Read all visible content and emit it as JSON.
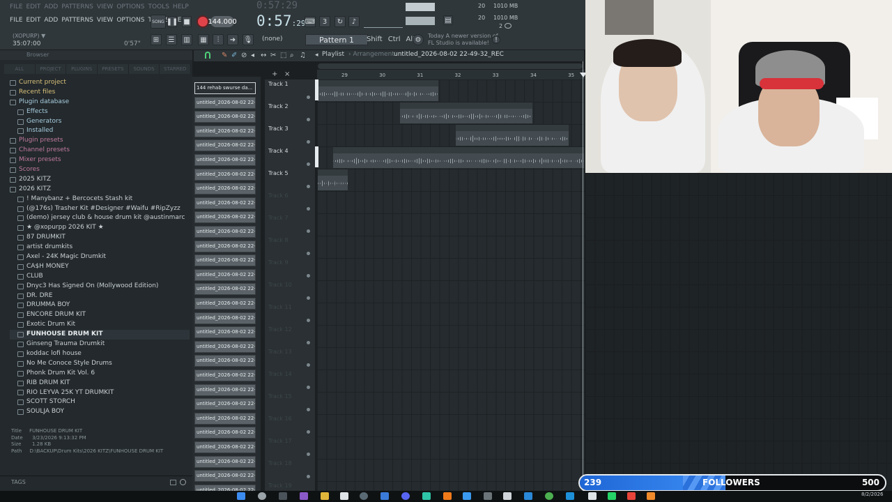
{
  "menu": {
    "items": [
      "FILE",
      "EDIT",
      "ADD",
      "PATTERNS",
      "VIEW",
      "OPTIONS",
      "TOOLS",
      "HELP"
    ]
  },
  "transport": {
    "tempo": "144.000",
    "clock": "0:57",
    "clock_small": ":29",
    "ghost_clock": "0:57:29",
    "song_label": "SONG"
  },
  "project": {
    "label": "(XOPURP) ▼",
    "time": "35:07:00",
    "hint_time": "0'57\""
  },
  "toolbar": {
    "none_label": "(none)",
    "pattern_label": "Pattern 1",
    "keys": [
      "Shift",
      "Ctrl",
      "Alt"
    ],
    "notice_line1": "Today  A newer version of",
    "notice_line2": "FL Studio is available!"
  },
  "status": {
    "cpu1": "20",
    "cpu2": "20",
    "mem1": "1010 MB",
    "mem2": "1010 MB",
    "mem3": "2"
  },
  "browser": {
    "header": "Browser",
    "tabs": [
      "ALL",
      "PROJECT",
      "PLUGINS",
      "PRESETS",
      "SOUNDS",
      "STARRED"
    ],
    "items": [
      {
        "label": "Current project",
        "kind": "cat"
      },
      {
        "label": "Recent files",
        "kind": "cat"
      },
      {
        "label": "Plugin database",
        "kind": "blue"
      },
      {
        "label": "Effects",
        "kind": "blue",
        "indent": 1
      },
      {
        "label": "Generators",
        "kind": "blue",
        "indent": 1
      },
      {
        "label": "Installed",
        "kind": "blue",
        "indent": 1
      },
      {
        "label": "Plugin presets",
        "kind": "cat2"
      },
      {
        "label": "Channel presets",
        "kind": "cat2"
      },
      {
        "label": "Mixer presets",
        "kind": "cat2"
      },
      {
        "label": "Scores",
        "kind": "cat2"
      },
      {
        "label": "2025 KITZ",
        "kind": "folder"
      },
      {
        "label": "2026 KITZ",
        "kind": "folder"
      },
      {
        "label": "! Manybanz + Bercocets Stash kit",
        "kind": "folder",
        "indent": 1
      },
      {
        "label": "(@176s) Trasher Kit #Designer #Waifu #RipZyzz",
        "kind": "folder",
        "indent": 1
      },
      {
        "label": "(demo) jersey club & house drum kit @austinmarc",
        "kind": "folder",
        "indent": 1
      },
      {
        "label": "★ @xopurpp 2026 KIT ★",
        "kind": "folder",
        "indent": 1
      },
      {
        "label": "87 DRUMKIT",
        "kind": "folder",
        "indent": 1
      },
      {
        "label": "artist drumkits",
        "kind": "folder",
        "indent": 1
      },
      {
        "label": "Axel - 24K Magic Drumkit",
        "kind": "folder",
        "indent": 1
      },
      {
        "label": "CA$H MONEY",
        "kind": "folder",
        "indent": 1
      },
      {
        "label": "CLUB",
        "kind": "folder",
        "indent": 1
      },
      {
        "label": "Dnyc3 Has Signed On (Mollywood Edition)",
        "kind": "folder",
        "indent": 1
      },
      {
        "label": "DR. DRE",
        "kind": "folder",
        "indent": 1
      },
      {
        "label": "DRUMMA BOY",
        "kind": "folder",
        "indent": 1
      },
      {
        "label": "ENCORE DRUM KIT",
        "kind": "folder",
        "indent": 1
      },
      {
        "label": "Exotic Drum Kit",
        "kind": "folder",
        "indent": 1
      },
      {
        "label": "FUNHOUSE DRUM KIT",
        "kind": "folder",
        "indent": 1,
        "selected": true
      },
      {
        "label": "Ginseng Trauma Drumkit",
        "kind": "folder",
        "indent": 1
      },
      {
        "label": "koddac lofi house",
        "kind": "folder",
        "indent": 1
      },
      {
        "label": "No Me Conoce Style Drums",
        "kind": "folder",
        "indent": 1
      },
      {
        "label": "Phonk Drum Kit Vol. 6",
        "kind": "folder",
        "indent": 1
      },
      {
        "label": "RIB DRUM KIT",
        "kind": "folder",
        "indent": 1
      },
      {
        "label": "RIO LEYVA 25K YT DRUMKIT",
        "kind": "folder",
        "indent": 1
      },
      {
        "label": "SCOTT STORCH",
        "kind": "folder",
        "indent": 1
      },
      {
        "label": "SOULJA BOY",
        "kind": "folder",
        "indent": 1
      }
    ],
    "info": {
      "title_k": "Title",
      "title_v": "FUNHOUSE DRUM KIT",
      "date_k": "Date",
      "date_v": "3/23/2026 9:13:32 PM",
      "size_k": "Size",
      "size_v": "1.28 KB",
      "path_k": "Path",
      "path_v": "D:\\BACKUP\\Drum Kits\\2026 KITZ\\FUNHOUSE DRUM KIT"
    },
    "tags": "TAGS"
  },
  "channels": {
    "items": [
      "144 rehab swurse da...",
      "untitled_2026-08-02 22-...",
      "untitled_2026-08-02 22-...",
      "untitled_2026-08-02 22-...",
      "untitled_2026-08-02 22-...",
      "untitled_2026-08-02 22-...",
      "untitled_2026-08-02 22-...",
      "untitled_2026-08-02 22-...",
      "untitled_2026-08-02 22-...",
      "untitled_2026-08-02 22-...",
      "untitled_2026-08-02 22-...",
      "untitled_2026-08-02 22-...",
      "untitled_2026-08-02 22-...",
      "untitled_2026-08-02 22-...",
      "untitled_2026-08-02 22-...",
      "untitled_2026-08-02 22-...",
      "untitled_2026-08-02 22-...",
      "untitled_2026-08-02 22-...",
      "untitled_2026-08-02 22-...",
      "untitled_2026-08-02 22-...",
      "untitled_2026-08-02 22-...",
      "untitled_2026-08-02 22-...",
      "untitled_2026-08-02 22-...",
      "untitled_2026-08-02 22-...",
      "untitled_2026-08-02 22-...",
      "untitled_2026-08-02 22-...",
      "untitled_2026-08-02 22-...",
      "untitled_2026-08-02 22-...",
      "untitled_2026-08-02 22-..."
    ]
  },
  "playlist": {
    "title": "Playlist",
    "arrangement": "› Arrangement",
    "name": "untitled_2026-08-02 22-49-32_REC",
    "ruler": [
      "29",
      "30",
      "31",
      "32",
      "33",
      "34",
      "35"
    ],
    "tracks": [
      "Track 1",
      "Track 2",
      "Track 3",
      "Track 4",
      "Track 5",
      "Track 6",
      "Track 7",
      "Track 8",
      "Track 9",
      "Track 10",
      "Track 11",
      "Track 12",
      "Track 13",
      "Track 14",
      "Track 15",
      "Track 16",
      "Track 17",
      "Track 18",
      "Track 19"
    ],
    "clips": [
      {
        "track": 0,
        "label": "144 rehab swurse darko",
        "start": 0.0,
        "len": 3.2
      },
      {
        "track": 1,
        "label": "untitled_2026-08-02 22-48-33_REC",
        "start": 2.18,
        "len": 3.5
      },
      {
        "track": 2,
        "label": "untitled_2026-08-02 22-48-54_REC",
        "start": 3.65,
        "len": 3.0
      },
      {
        "track": 3,
        "label": "untitled_2026-08-02 22-47-43_REC",
        "start": 0.4,
        "len": 4.2
      },
      {
        "track": 3,
        "label": "untitled_2026-08-02 22-49-11_REC",
        "start": 4.6,
        "len": 2.5
      },
      {
        "track": 4,
        "label": "untit..REC",
        "start": 0.0,
        "len": 0.8
      }
    ]
  },
  "followers": {
    "current": "239",
    "label": "FOLLOWERS",
    "max": "500",
    "progress": 0.478
  },
  "taskbar": {
    "date": "8/2/2026"
  }
}
